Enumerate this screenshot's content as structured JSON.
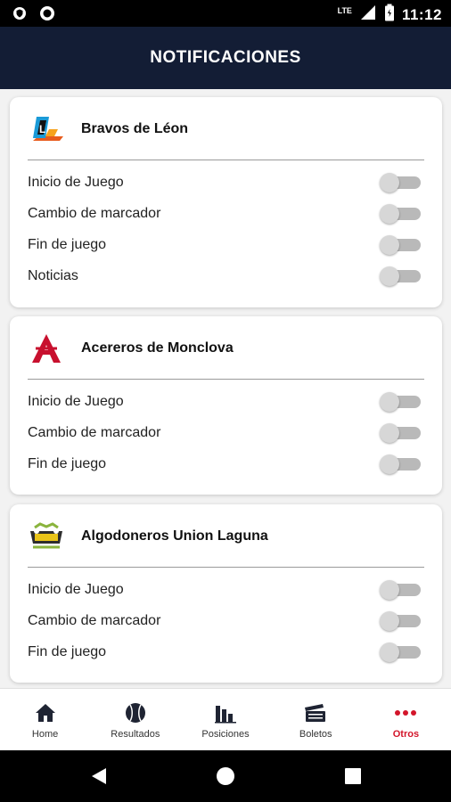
{
  "status_bar": {
    "time": "11:12",
    "network": "LTE"
  },
  "header": {
    "title": "NOTIFICACIONES"
  },
  "colors": {
    "header_bg": "#131d35",
    "accent": "#d3152a"
  },
  "cards": [
    {
      "team": "Bravos de Léon",
      "logo_icon": "bravos-logo-icon",
      "rows": [
        {
          "label": "Inicio de Juego",
          "enabled": false
        },
        {
          "label": "Cambio de marcador",
          "enabled": false
        },
        {
          "label": "Fin de juego",
          "enabled": false
        },
        {
          "label": "Noticias",
          "enabled": false
        }
      ]
    },
    {
      "team": "Acereros de Monclova",
      "logo_icon": "acereros-logo-icon",
      "rows": [
        {
          "label": "Inicio de Juego",
          "enabled": false
        },
        {
          "label": "Cambio de marcador",
          "enabled": false
        },
        {
          "label": "Fin de juego",
          "enabled": false
        }
      ]
    },
    {
      "team": "Algodoneros Union Laguna",
      "logo_icon": "algodoneros-logo-icon",
      "rows": [
        {
          "label": "Inicio de Juego",
          "enabled": false
        },
        {
          "label": "Cambio de marcador",
          "enabled": false
        },
        {
          "label": "Fin de juego",
          "enabled": false
        }
      ]
    }
  ],
  "bottom_nav": {
    "items": [
      {
        "label": "Home",
        "icon": "home-icon"
      },
      {
        "label": "Resultados",
        "icon": "baseball-icon"
      },
      {
        "label": "Posiciones",
        "icon": "bar-chart-icon"
      },
      {
        "label": "Boletos",
        "icon": "tickets-icon"
      },
      {
        "label": "Otros",
        "icon": "more-dots-icon",
        "active": true
      }
    ]
  }
}
